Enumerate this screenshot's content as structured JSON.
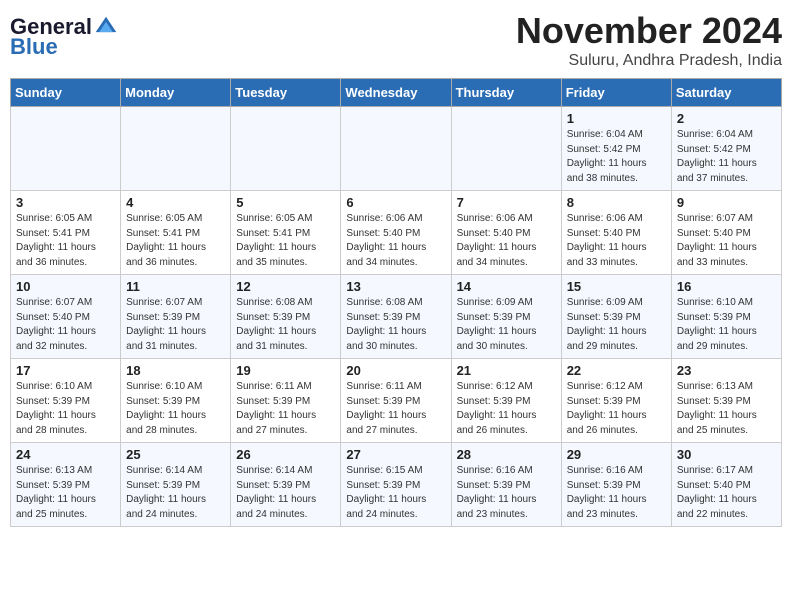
{
  "header": {
    "logo_line1": "General",
    "logo_line2": "Blue",
    "month": "November 2024",
    "location": "Suluru, Andhra Pradesh, India"
  },
  "weekdays": [
    "Sunday",
    "Monday",
    "Tuesday",
    "Wednesday",
    "Thursday",
    "Friday",
    "Saturday"
  ],
  "weeks": [
    [
      {
        "day": "",
        "info": ""
      },
      {
        "day": "",
        "info": ""
      },
      {
        "day": "",
        "info": ""
      },
      {
        "day": "",
        "info": ""
      },
      {
        "day": "",
        "info": ""
      },
      {
        "day": "1",
        "info": "Sunrise: 6:04 AM\nSunset: 5:42 PM\nDaylight: 11 hours\nand 38 minutes."
      },
      {
        "day": "2",
        "info": "Sunrise: 6:04 AM\nSunset: 5:42 PM\nDaylight: 11 hours\nand 37 minutes."
      }
    ],
    [
      {
        "day": "3",
        "info": "Sunrise: 6:05 AM\nSunset: 5:41 PM\nDaylight: 11 hours\nand 36 minutes."
      },
      {
        "day": "4",
        "info": "Sunrise: 6:05 AM\nSunset: 5:41 PM\nDaylight: 11 hours\nand 36 minutes."
      },
      {
        "day": "5",
        "info": "Sunrise: 6:05 AM\nSunset: 5:41 PM\nDaylight: 11 hours\nand 35 minutes."
      },
      {
        "day": "6",
        "info": "Sunrise: 6:06 AM\nSunset: 5:40 PM\nDaylight: 11 hours\nand 34 minutes."
      },
      {
        "day": "7",
        "info": "Sunrise: 6:06 AM\nSunset: 5:40 PM\nDaylight: 11 hours\nand 34 minutes."
      },
      {
        "day": "8",
        "info": "Sunrise: 6:06 AM\nSunset: 5:40 PM\nDaylight: 11 hours\nand 33 minutes."
      },
      {
        "day": "9",
        "info": "Sunrise: 6:07 AM\nSunset: 5:40 PM\nDaylight: 11 hours\nand 33 minutes."
      }
    ],
    [
      {
        "day": "10",
        "info": "Sunrise: 6:07 AM\nSunset: 5:40 PM\nDaylight: 11 hours\nand 32 minutes."
      },
      {
        "day": "11",
        "info": "Sunrise: 6:07 AM\nSunset: 5:39 PM\nDaylight: 11 hours\nand 31 minutes."
      },
      {
        "day": "12",
        "info": "Sunrise: 6:08 AM\nSunset: 5:39 PM\nDaylight: 11 hours\nand 31 minutes."
      },
      {
        "day": "13",
        "info": "Sunrise: 6:08 AM\nSunset: 5:39 PM\nDaylight: 11 hours\nand 30 minutes."
      },
      {
        "day": "14",
        "info": "Sunrise: 6:09 AM\nSunset: 5:39 PM\nDaylight: 11 hours\nand 30 minutes."
      },
      {
        "day": "15",
        "info": "Sunrise: 6:09 AM\nSunset: 5:39 PM\nDaylight: 11 hours\nand 29 minutes."
      },
      {
        "day": "16",
        "info": "Sunrise: 6:10 AM\nSunset: 5:39 PM\nDaylight: 11 hours\nand 29 minutes."
      }
    ],
    [
      {
        "day": "17",
        "info": "Sunrise: 6:10 AM\nSunset: 5:39 PM\nDaylight: 11 hours\nand 28 minutes."
      },
      {
        "day": "18",
        "info": "Sunrise: 6:10 AM\nSunset: 5:39 PM\nDaylight: 11 hours\nand 28 minutes."
      },
      {
        "day": "19",
        "info": "Sunrise: 6:11 AM\nSunset: 5:39 PM\nDaylight: 11 hours\nand 27 minutes."
      },
      {
        "day": "20",
        "info": "Sunrise: 6:11 AM\nSunset: 5:39 PM\nDaylight: 11 hours\nand 27 minutes."
      },
      {
        "day": "21",
        "info": "Sunrise: 6:12 AM\nSunset: 5:39 PM\nDaylight: 11 hours\nand 26 minutes."
      },
      {
        "day": "22",
        "info": "Sunrise: 6:12 AM\nSunset: 5:39 PM\nDaylight: 11 hours\nand 26 minutes."
      },
      {
        "day": "23",
        "info": "Sunrise: 6:13 AM\nSunset: 5:39 PM\nDaylight: 11 hours\nand 25 minutes."
      }
    ],
    [
      {
        "day": "24",
        "info": "Sunrise: 6:13 AM\nSunset: 5:39 PM\nDaylight: 11 hours\nand 25 minutes."
      },
      {
        "day": "25",
        "info": "Sunrise: 6:14 AM\nSunset: 5:39 PM\nDaylight: 11 hours\nand 24 minutes."
      },
      {
        "day": "26",
        "info": "Sunrise: 6:14 AM\nSunset: 5:39 PM\nDaylight: 11 hours\nand 24 minutes."
      },
      {
        "day": "27",
        "info": "Sunrise: 6:15 AM\nSunset: 5:39 PM\nDaylight: 11 hours\nand 24 minutes."
      },
      {
        "day": "28",
        "info": "Sunrise: 6:16 AM\nSunset: 5:39 PM\nDaylight: 11 hours\nand 23 minutes."
      },
      {
        "day": "29",
        "info": "Sunrise: 6:16 AM\nSunset: 5:39 PM\nDaylight: 11 hours\nand 23 minutes."
      },
      {
        "day": "30",
        "info": "Sunrise: 6:17 AM\nSunset: 5:40 PM\nDaylight: 11 hours\nand 22 minutes."
      }
    ]
  ]
}
